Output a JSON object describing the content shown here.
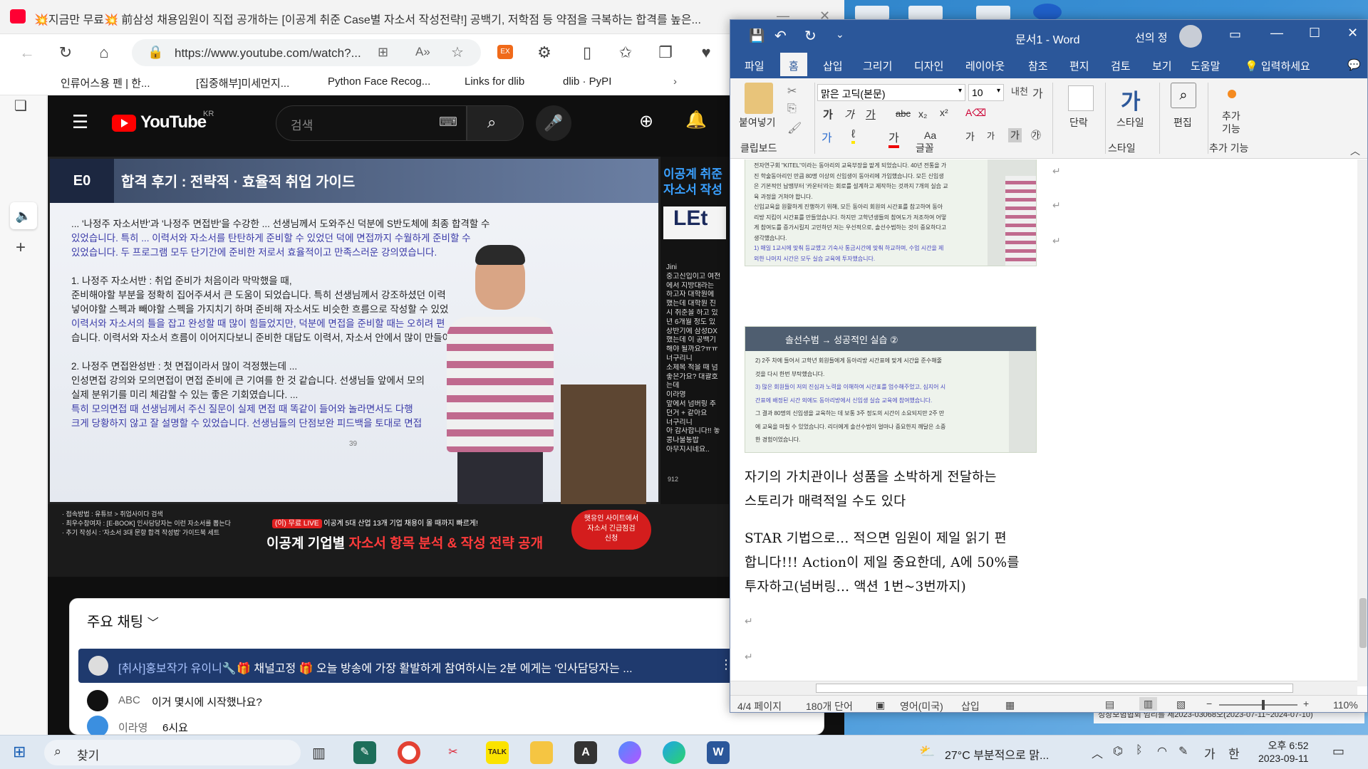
{
  "edge": {
    "tab_title": "💥지금만 무료💥 前삼성 채용임원이 직접 공개하는 [이공계 취준 Case별 자소서 작성전략!] 공백기, 저학점 등 약점을 극복하는 합격를 높은...",
    "url": "https://www.youtube.com/watch?...",
    "favorites": [
      "인류어스용 펜 | 한...",
      "[집중해부]미세먼지...",
      "Python Face Recog...",
      "Links for dlib",
      "dlib · PyPI"
    ]
  },
  "youtube": {
    "logo_text": "YouTube",
    "region": "KR",
    "search_placeholder": "검색",
    "slide": {
      "tag": "E0",
      "title": "합격 후기 : 전략적 · 효율적 취업 가이드",
      "lines": [
        "... '나정주 자소서반'과 '나정주 면접반'을 수강한 ... 선생님께서 도와주신 덕분에 S반도체에 최종 합격할 수",
        "있었습니다. 특히 ... 이력서와 자소서를 탄탄하게 준비할 수 있었던 덕에 면접까지 수월하게 준비할 수",
        "있었습니다. 두 프로그램 모두 단기간에 준비한 저로서 효율적이고 만족스러운 강의였습니다.",
        "1. 나정주 자소서반 : 취업 준비가 처음이라 막막했을 때,",
        "준비해야할 부분을 정확히 집어주셔서 큰 도움이 되었습니다. 특히 선생님께서 강조하셨던 이력",
        "넣어야할 스펙과 빼야할 스펙을 가지치기 하며 준비해 자소서도 비슷한 흐름으로 작성할 수 있었",
        "이력서와 자소서의 틀을 잡고 완성할 때 많이 힘들었지만, 덕분에 면접을 준비할 때는 오히려 편",
        "습니다. 이력서와 자소서 흐름이 이어지다보니 준비한 대답도 이력서, 자소서 안에서 많이 만들어졌",
        "2. 나정주 면접완성반 : 첫 면접이라서 많이 걱정했는데 ...",
        "인성면접 강의와 모의면접이 면접 준비에 큰 기여를 한 것 같습니다. 선생님들 앞에서 모의",
        "실제 분위기를 미리 체감할 수 있는 좋은 기회였습니다. ...",
        "특히 모의면접 때 선생님께서 주신 질문이 실제 면접 때 똑같이 들어와 놀라면서도 다행",
        "크게 당황하지 않고 잘 설명할 수 있었습니다. 선생님들의 단점보완 피드백을 토대로 면접"
      ],
      "page_no": "39"
    },
    "right_panel": {
      "header": "이공계 취준 자소서 작성",
      "logo": "LEt",
      "chat_lines": [
        "Jini",
        "중고신입이고 여전",
        "에서 지방대라는",
        "하고자 대학원에",
        "했는데 대학원 진",
        "시 취준을 하고 있",
        "년 6개월 정도 있",
        "상반기에 삼성DX",
        "했는데 이 공백기",
        "해야 될까요?ㅠㅠ",
        "너구리니",
        "소제목 적을 때 넘",
        "좋은가요? 대괄호",
        "는데",
        "이라영",
        "앞에서 넘버링 추",
        "던거 + 같아요",
        "너구리니",
        "아 감사합니다!! 놓",
        "콩나물통밥",
        "아무지시네요.."
      ],
      "count": "912"
    },
    "banner": {
      "left_lines": [
        "· 접속방법 : 유튜브 > 취업사이다 검색",
        "· 최우수참여자 : [E-BOOK] 인사담당자는 이런 자소서를 뽑는다",
        "· 추기 작성시 : '자소서 3대 문항 합격 작성법' 가이드북 세트"
      ],
      "live_tag": "(이) 무료 LIVE",
      "live_sub": "이공계 5대 산업 13개 기업 채용이 몰 때까지 빠르게!",
      "headline_white": "이공계 기업별 ",
      "headline_red": "자소서 항목 분석 & 작성 전략 공개",
      "cta_line1": "햇유인 사이트에서",
      "cta_line2": "자소서 긴급점검",
      "cta_line3": "신청"
    },
    "chat": {
      "title": "주요 채팅",
      "pinned_author": "[취사]홍보작가 유이니🔧",
      "pinned_text": "🎁 채널고정 🎁 오늘 방송에 가장 활발하게 참여하시는 2분 에게는 '인사담당자는 ...",
      "messages": [
        {
          "author": "ABC",
          "text": "이거 몇시에 시작했나요?"
        },
        {
          "author": "이라영",
          "text": "6시요"
        }
      ]
    }
  },
  "word": {
    "doc_name": "문서1",
    "app_name": "Word",
    "user_name": "선의 정",
    "tabs": [
      "파일",
      "홈",
      "삽입",
      "그리기",
      "디자인",
      "레이아웃",
      "참조",
      "편지",
      "검토",
      "보기",
      "도움말",
      "입력하세요"
    ],
    "font_name": "맑은 고딕(본문)",
    "font_size": "10",
    "groups": {
      "clipboard": "클립보드",
      "font": "글꼴",
      "paragraph": "단락",
      "styles": "스타일",
      "styles_label": "스타일",
      "edit": "편집",
      "addins": "추가 기능",
      "addins_label": "추가\n기능",
      "paste_label": "붙여넣기"
    },
    "doc_image1": {
      "lines": [
        "전자연구회 \"KITEL\"이라는 동아리의 교육부장을 맡게 되었습니다. 40년 전통을 가",
        "진 학술동아리인 만큼 80명 이상의 신입생이 동아리에 가입했습니다. 모든 신입생",
        "은 기본적인 납땜부터 '카운터'라는 회로를 설계하고 제작하는 것까지 7개의 실습 교",
        "육 과정을 거쳐야 합니다.",
        "신입교육을 원활하게 진행하기 위해, 모든 동아리 회원의 시간표를 참고하여 동아",
        "리방 지킴이 시간표를 만들었습니다. 하지만 고학년생들의 참여도가 저조하여 어떻",
        "게 참여도를 증가시킬지 고민하던 저는 우선적으로, 솔선수범하는 것이 중요하다고",
        "생각했습니다.",
        "1) 매일 1교시에 맞춰 등교했고 기숙사 통금시간에 맞춰 하교하며, 수업 시간을 제",
        "외한 나머지 시간은 모두 실습 교육에 투자했습니다."
      ]
    },
    "doc_image2": {
      "header": "솔선수범 → 성공적인 실습 ②",
      "lines": [
        "2) 2주 차에 들어서 고학년 회원들에게 동아리방 시간표에 맞게 시간을 준수해줄",
        "것을 다시 한번 부탁했습니다.",
        "3) 많은 회원들이 저의 진심과 노력을 이해하여 시간표를 엄수해주었고, 심지어 시",
        "간표에 배정된 시간 외에도 동아리방에서 신입생 실습 교육에 참여했습니다.",
        "그 결과 80명의 신입생을 교육하는 데 보통 3주 정도의 시간이 소요되지만 2주 만",
        "에 교육을 마칠 수 있었습니다. 리더에게 솔선수범이 얼마나 중요한지 깨달은 소중",
        "한 경험이었습니다."
      ]
    },
    "doc_text": [
      "자기의 가치관이나 성품을 소박하게 전달하는",
      "스토리가 매력적일 수도 있다",
      "STAR 기법으로... 적으면 임원이 제일 읽기 편",
      "합니다!!! Action이 제일 중요한데, A에 50%를",
      "투자하고(넘버링... 액션 1번~3번까지)"
    ],
    "status": {
      "page": "4/4 페이지",
      "words": "180개 단어",
      "lang": "영어(미국)",
      "mode": "삽입",
      "zoom": "110%"
    }
  },
  "taskbar": {
    "search_label": "찾기",
    "weather": "27°C  부분적으로 맑...",
    "ime": "가",
    "ime2": "한",
    "time": "오후 6:52",
    "date": "2023-09-11",
    "behind_text": "성장보험협회 임리를 세2023-03068오(2023-07-11~2024-07-10)"
  },
  "colors": {
    "word_blue": "#2b579a",
    "yt_red": "#ff0000",
    "slide_highlight": "#3a3aa8"
  }
}
